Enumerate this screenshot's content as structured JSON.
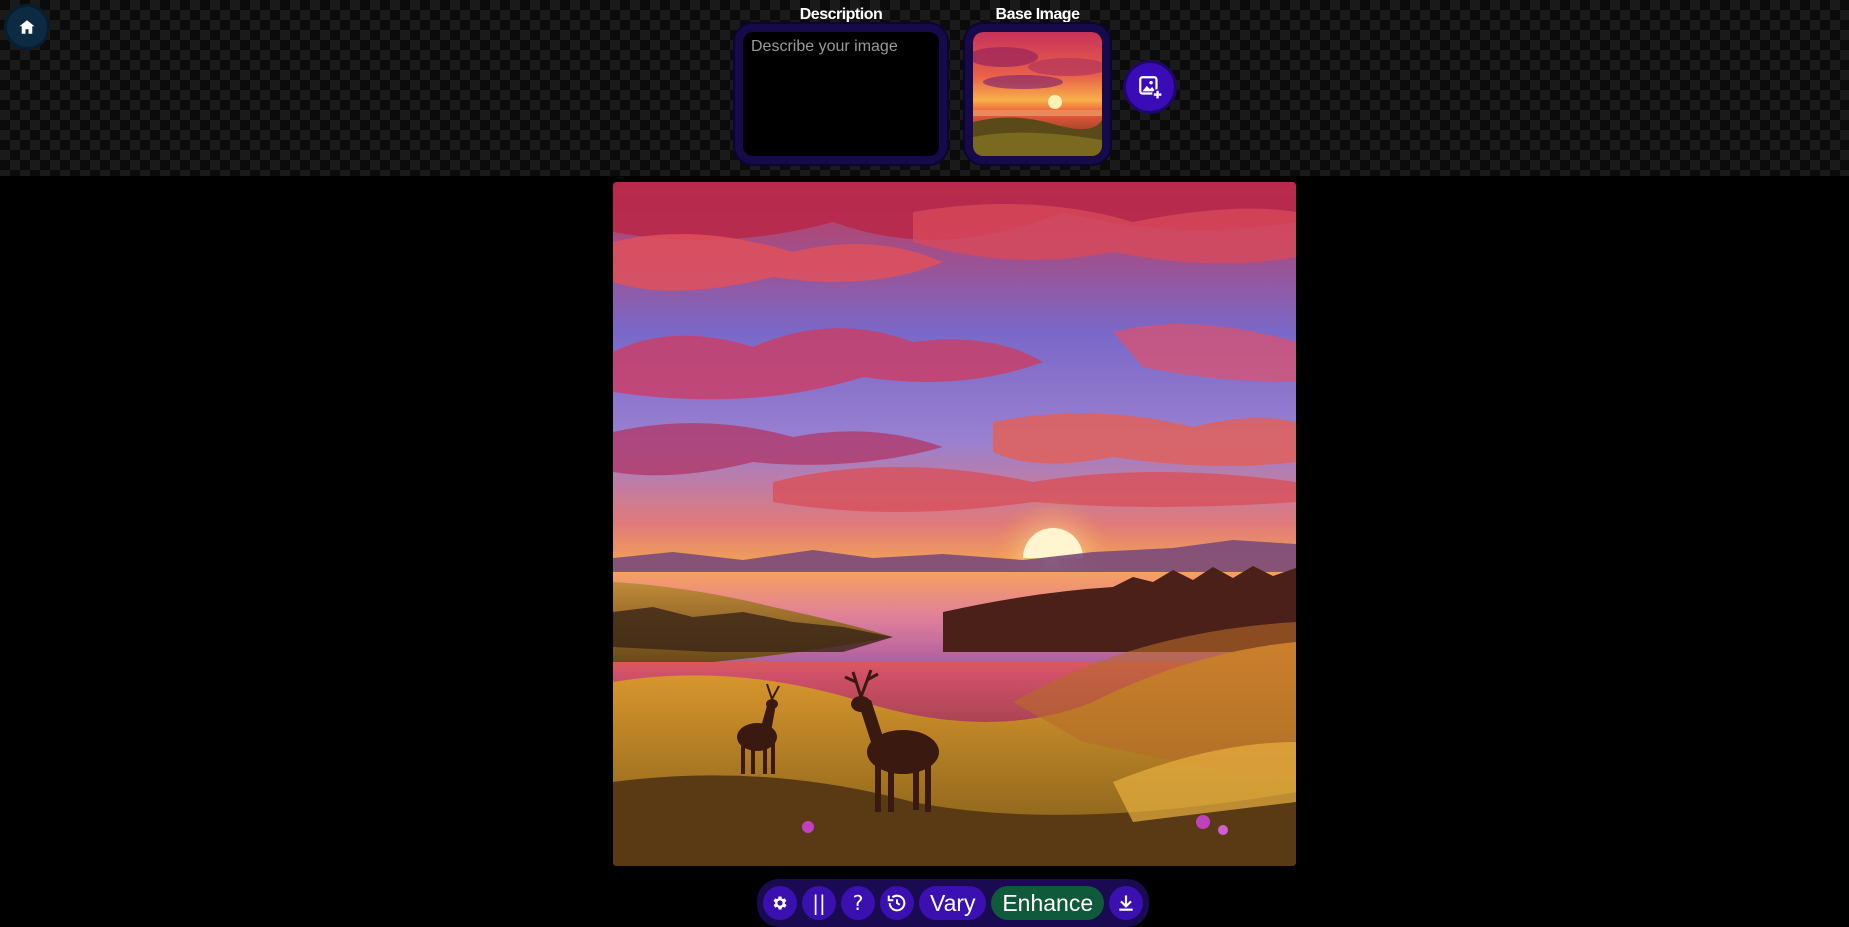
{
  "header": {
    "home_icon": "home-icon",
    "description_label": "Description",
    "description_placeholder": "Describe your image",
    "description_value": "",
    "base_image_label": "Base Image",
    "add_image_icon": "add-image-icon"
  },
  "toolbar": {
    "settings_icon": "gear-icon",
    "pause_label": "||",
    "help_label": "?",
    "history_icon": "history-icon",
    "vary_label": "Vary",
    "enhance_label": "Enhance",
    "download_icon": "download-icon"
  },
  "colors": {
    "accent": "#3a11b0",
    "toolbar_bg": "#1a0a52",
    "enhance": "#0f5a3a",
    "home": "#0c2b42"
  }
}
